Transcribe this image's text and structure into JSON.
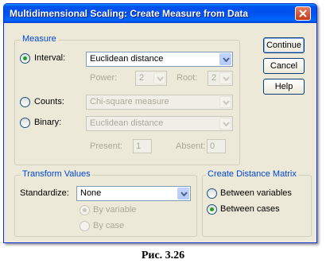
{
  "window": {
    "title": "Multidimensional Scaling: Create Measure from Data"
  },
  "buttons": {
    "continue": "Continue",
    "cancel": "Cancel",
    "help": "Help"
  },
  "measure": {
    "title": "Measure",
    "interval": {
      "label": "Interval:",
      "selected": "Euclidean distance"
    },
    "power": {
      "label": "Power:",
      "value": "2"
    },
    "root": {
      "label": "Root:",
      "value": "2"
    },
    "counts": {
      "label": "Counts:",
      "selected": "Chi-square measure"
    },
    "binary": {
      "label": "Binary:",
      "selected": "Euclidean distance"
    },
    "present": {
      "label": "Present:",
      "value": "1"
    },
    "absent": {
      "label": "Absent:",
      "value": "0"
    }
  },
  "transform": {
    "title": "Transform Values",
    "standardize_label": "Standardize:",
    "standardize_value": "None",
    "by_variable": "By variable",
    "by_case": "By case"
  },
  "distance": {
    "title": "Create Distance Matrix",
    "between_variables": "Between variables",
    "between_cases": "Between cases"
  },
  "caption": "Рис. 3.26",
  "colors": {
    "title_bar": "#0054e3",
    "group_title": "#0046d5",
    "dialog_bg": "#ece9d8"
  }
}
